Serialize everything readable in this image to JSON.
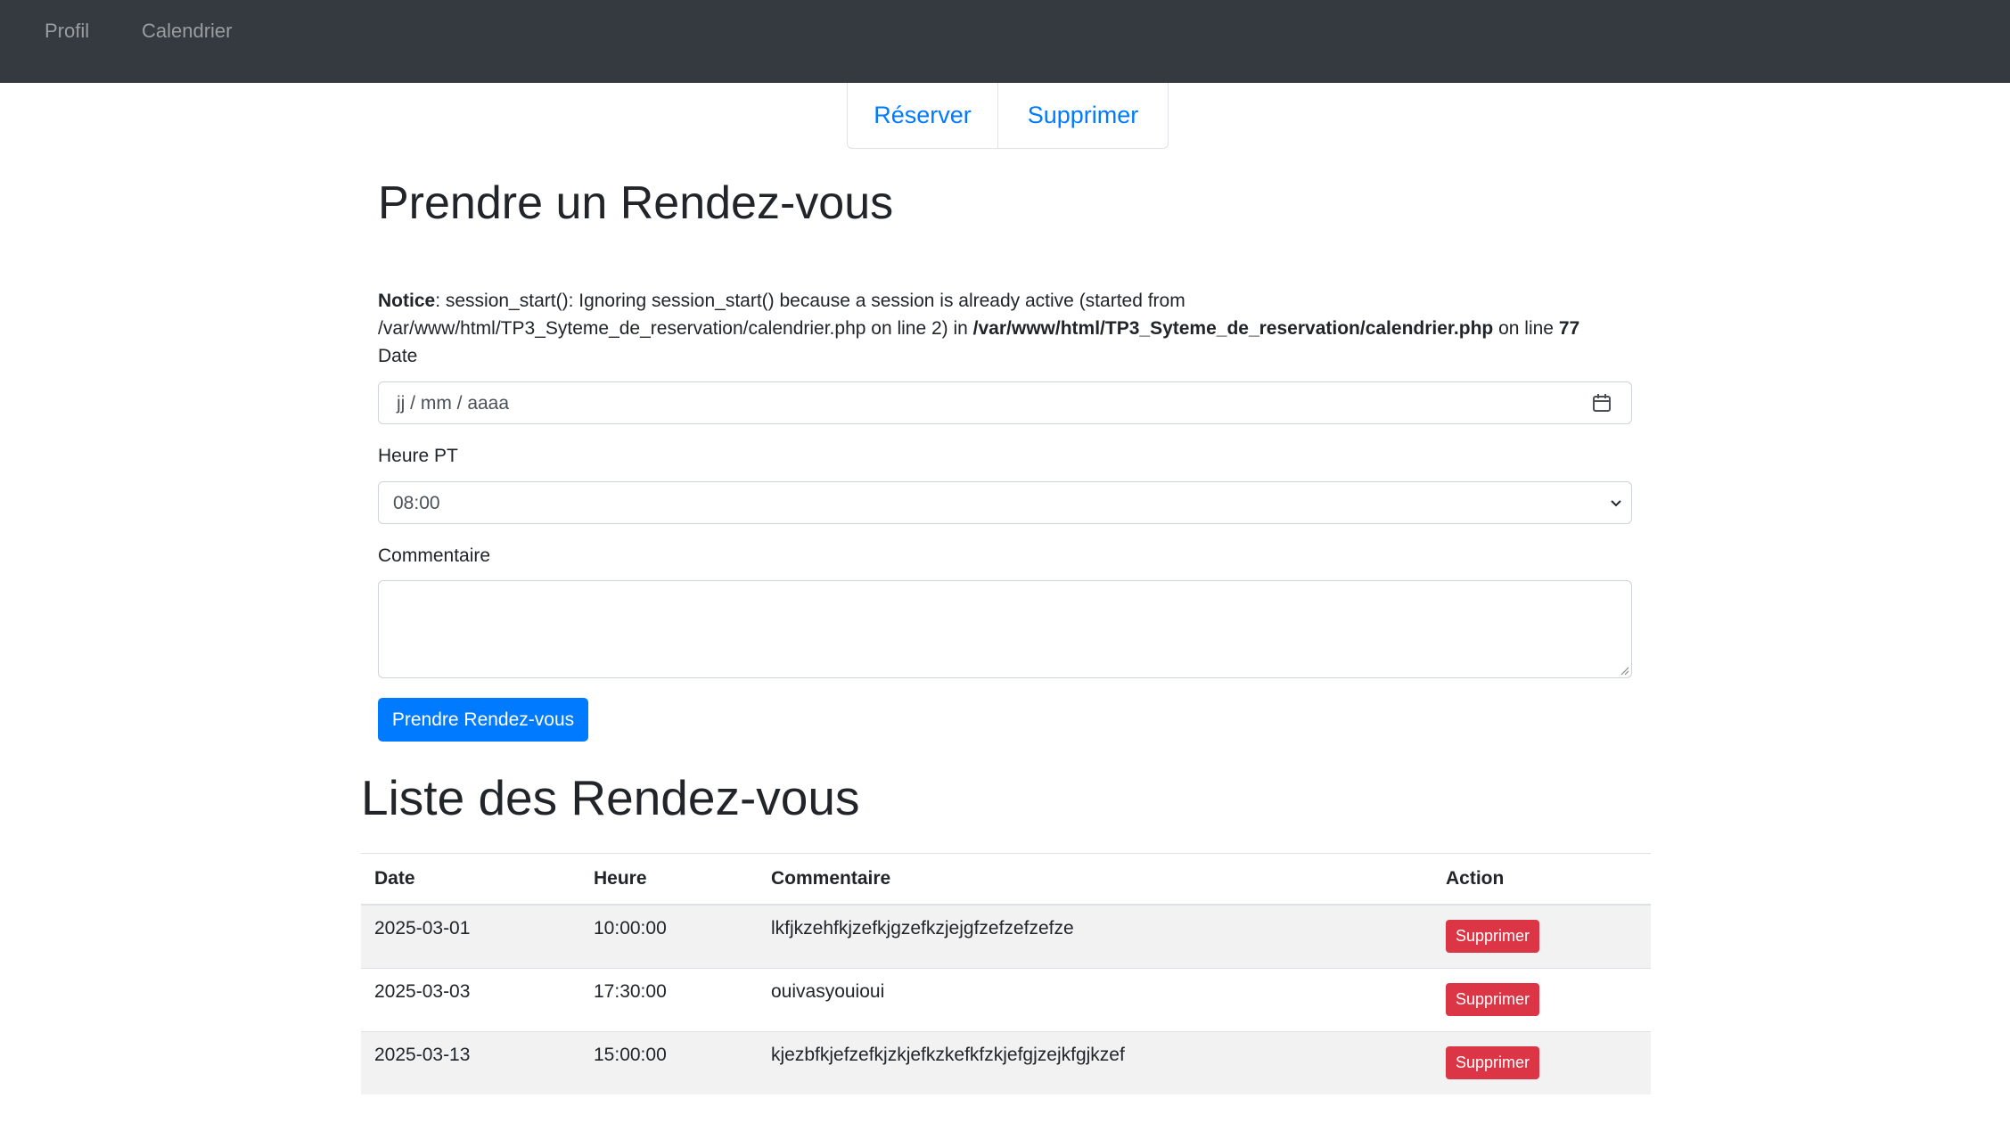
{
  "navbar": {
    "items": [
      {
        "label": "Profil"
      },
      {
        "label": "Calendrier"
      }
    ]
  },
  "tabs": [
    {
      "label": "Réserver"
    },
    {
      "label": "Supprimer"
    }
  ],
  "form": {
    "title": "Prendre un Rendez-vous",
    "notice": {
      "label": "Notice",
      "message": ": session_start(): Ignoring session_start() because a session is already active (started from /var/www/html/TP3_Syteme_de_reservation/calendrier.php on line 2) in ",
      "path": "/var/www/html/TP3_Syteme_de_reservation/calendrier.php",
      "line_text": " on line ",
      "line": "77"
    },
    "date_label": "Date",
    "date_placeholder": "jj / mm / aaaa",
    "time_label": "Heure PT",
    "time_value": "08:00",
    "comment_label": "Commentaire",
    "comment_value": "",
    "submit_label": "Prendre Rendez-vous"
  },
  "list": {
    "title": "Liste des Rendez-vous",
    "columns": [
      "Date",
      "Heure",
      "Commentaire",
      "Action"
    ],
    "rows": [
      {
        "date": "2025-03-01",
        "time": "10:00:00",
        "comment": "lkfjkzehfkjzefkjgzefkzjejgfzefzefzefze",
        "action": "Supprimer"
      },
      {
        "date": "2025-03-03",
        "time": "17:30:00",
        "comment": "ouivasyouioui",
        "action": "Supprimer"
      },
      {
        "date": "2025-03-13",
        "time": "15:00:00",
        "comment": "kjezbfkjefzefkjzkjefkzkefkfzkjefgjzejkfgjkzef",
        "action": "Supprimer"
      }
    ]
  },
  "colors": {
    "navbar_bg": "#343a40",
    "primary": "#007bff",
    "danger": "#dc3545",
    "stripe": "#f2f2f2"
  }
}
